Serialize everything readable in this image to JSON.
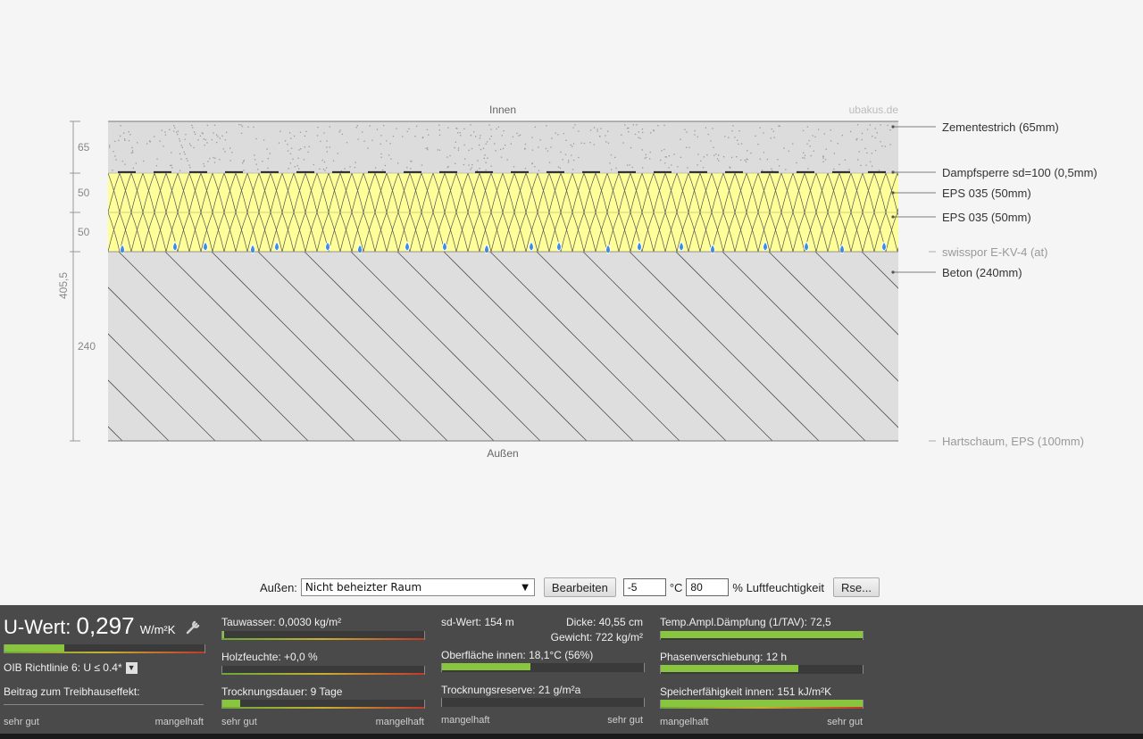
{
  "diagram": {
    "top_label": "Innen",
    "bottom_label": "Außen",
    "watermark": "ubakus.de",
    "total_label": "405,5",
    "dimensions": [
      "65",
      "50",
      "50",
      "240"
    ],
    "layers": [
      {
        "label": "Zementestrich (65mm)",
        "muted": false
      },
      {
        "label": "Dampfsperre sd=100 (0,5mm)",
        "muted": false
      },
      {
        "label": "EPS 035 (50mm)",
        "muted": false
      },
      {
        "label": "EPS 035 (50mm)",
        "muted": false
      },
      {
        "label": "swisspor E-KV-4 (at)",
        "muted": true
      },
      {
        "label": "Beton (240mm)",
        "muted": false
      },
      {
        "label": "Hartschaum, EPS (100mm)",
        "muted": true
      }
    ],
    "colors": {
      "screed": "#dcdcdc",
      "insulation": "#ffff99",
      "concrete": "#dedede",
      "water": "#3a8ee6"
    }
  },
  "controls": {
    "outside_label": "Außen:",
    "outside_value": "Nicht beheizter Raum",
    "edit_button": "Bearbeiten",
    "temperature": "-5",
    "temperature_unit": "°C",
    "humidity": "80",
    "humidity_unit": "% Luftfeuchtigkeit",
    "rse_button": "Rse..."
  },
  "results": {
    "uwert": {
      "prefix": "U-Wert:",
      "value": "0,297",
      "unit": "W/m²K",
      "fraction": 0.3,
      "oib": "OIB Richtlinie 6: U ≤ 0.4*",
      "greenhouse": "Beitrag zum Treibhauseffekt:",
      "scale_left": "sehr gut",
      "scale_right": "mangelhaft"
    },
    "col2": {
      "tauwasser": "Tauwasser: 0,0030 kg/m²",
      "tauwasser_fraction": 0.01,
      "holzfeuchte": "Holzfeuchte: +0,0 %",
      "holzfeuchte_fraction": 0.0,
      "trocknung": "Trocknungsdauer: 9 Tage",
      "trocknung_fraction": 0.09,
      "scale_left": "sehr gut",
      "scale_right": "mangelhaft"
    },
    "col3": {
      "sd": "sd-Wert: 154 m",
      "dicke": "Dicke: 40,55 cm",
      "gewicht": "Gewicht: 722 kg/m²",
      "oberflaeche": "Oberfläche innen: 18,1°C (56%)",
      "oberflaeche_fraction": 0.44,
      "reserve": "Trocknungsreserve: 21 g/m²a",
      "reserve_fraction": 0.0,
      "scale_left": "mangelhaft",
      "scale_right": "sehr gut"
    },
    "col4": {
      "tav": "Temp.Ampl.Dämpfung (1/TAV): 72,5",
      "tav_fraction": 1.0,
      "phase": "Phasenverschiebung: 12 h",
      "phase_fraction": 0.68,
      "speicher": "Speicherfähigkeit innen: 151 kJ/m²K",
      "speicher_fraction": 1.0,
      "scale_left": "mangelhaft",
      "scale_right": "sehr gut"
    }
  }
}
